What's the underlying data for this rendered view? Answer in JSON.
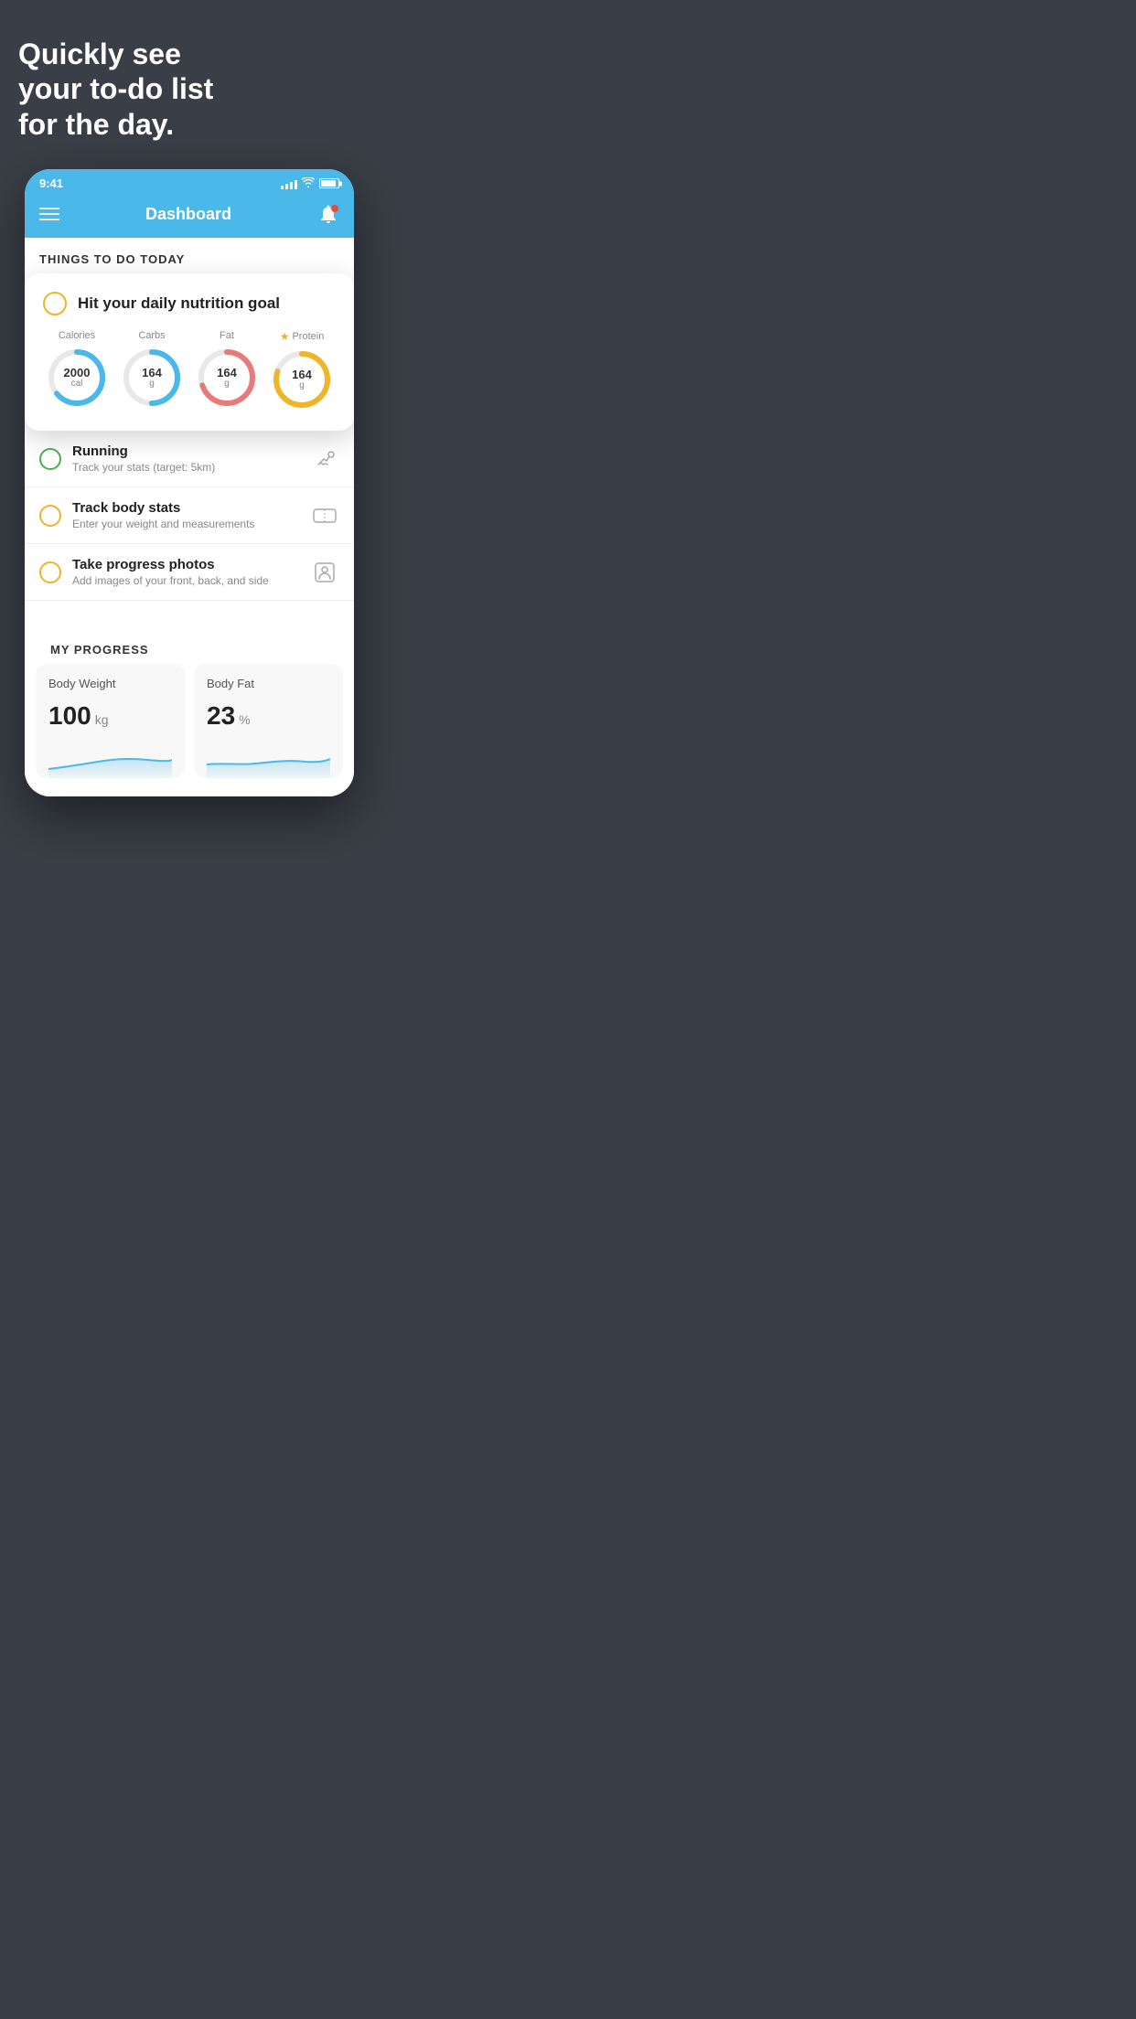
{
  "page": {
    "headline": "Quickly see\nyour to-do list\nfor the day.",
    "status_time": "9:41",
    "header_title": "Dashboard",
    "things_label": "THINGS TO DO TODAY",
    "popup": {
      "title": "Hit your daily nutrition goal",
      "items": [
        {
          "label": "Calories",
          "value": "2000",
          "unit": "cal",
          "color": "#4ab8e8",
          "percent": 65
        },
        {
          "label": "Carbs",
          "value": "164",
          "unit": "g",
          "color": "#4ab8e8",
          "percent": 50
        },
        {
          "label": "Fat",
          "value": "164",
          "unit": "g",
          "color": "#e87a7a",
          "percent": 70
        },
        {
          "label": "Protein",
          "value": "164",
          "unit": "g",
          "color": "#f0b429",
          "percent": 80,
          "starred": true
        }
      ]
    },
    "todo_items": [
      {
        "name": "Running",
        "sub": "Track your stats (target: 5km)",
        "circle_color": "green",
        "icon": "🏃"
      },
      {
        "name": "Track body stats",
        "sub": "Enter your weight and measurements",
        "circle_color": "yellow",
        "icon": "⚖️"
      },
      {
        "name": "Take progress photos",
        "sub": "Add images of your front, back, and side",
        "circle_color": "yellow",
        "icon": "👤"
      }
    ],
    "progress_label": "MY PROGRESS",
    "progress_cards": [
      {
        "title": "Body Weight",
        "value": "100",
        "unit": "kg"
      },
      {
        "title": "Body Fat",
        "value": "23",
        "unit": "%"
      }
    ]
  }
}
